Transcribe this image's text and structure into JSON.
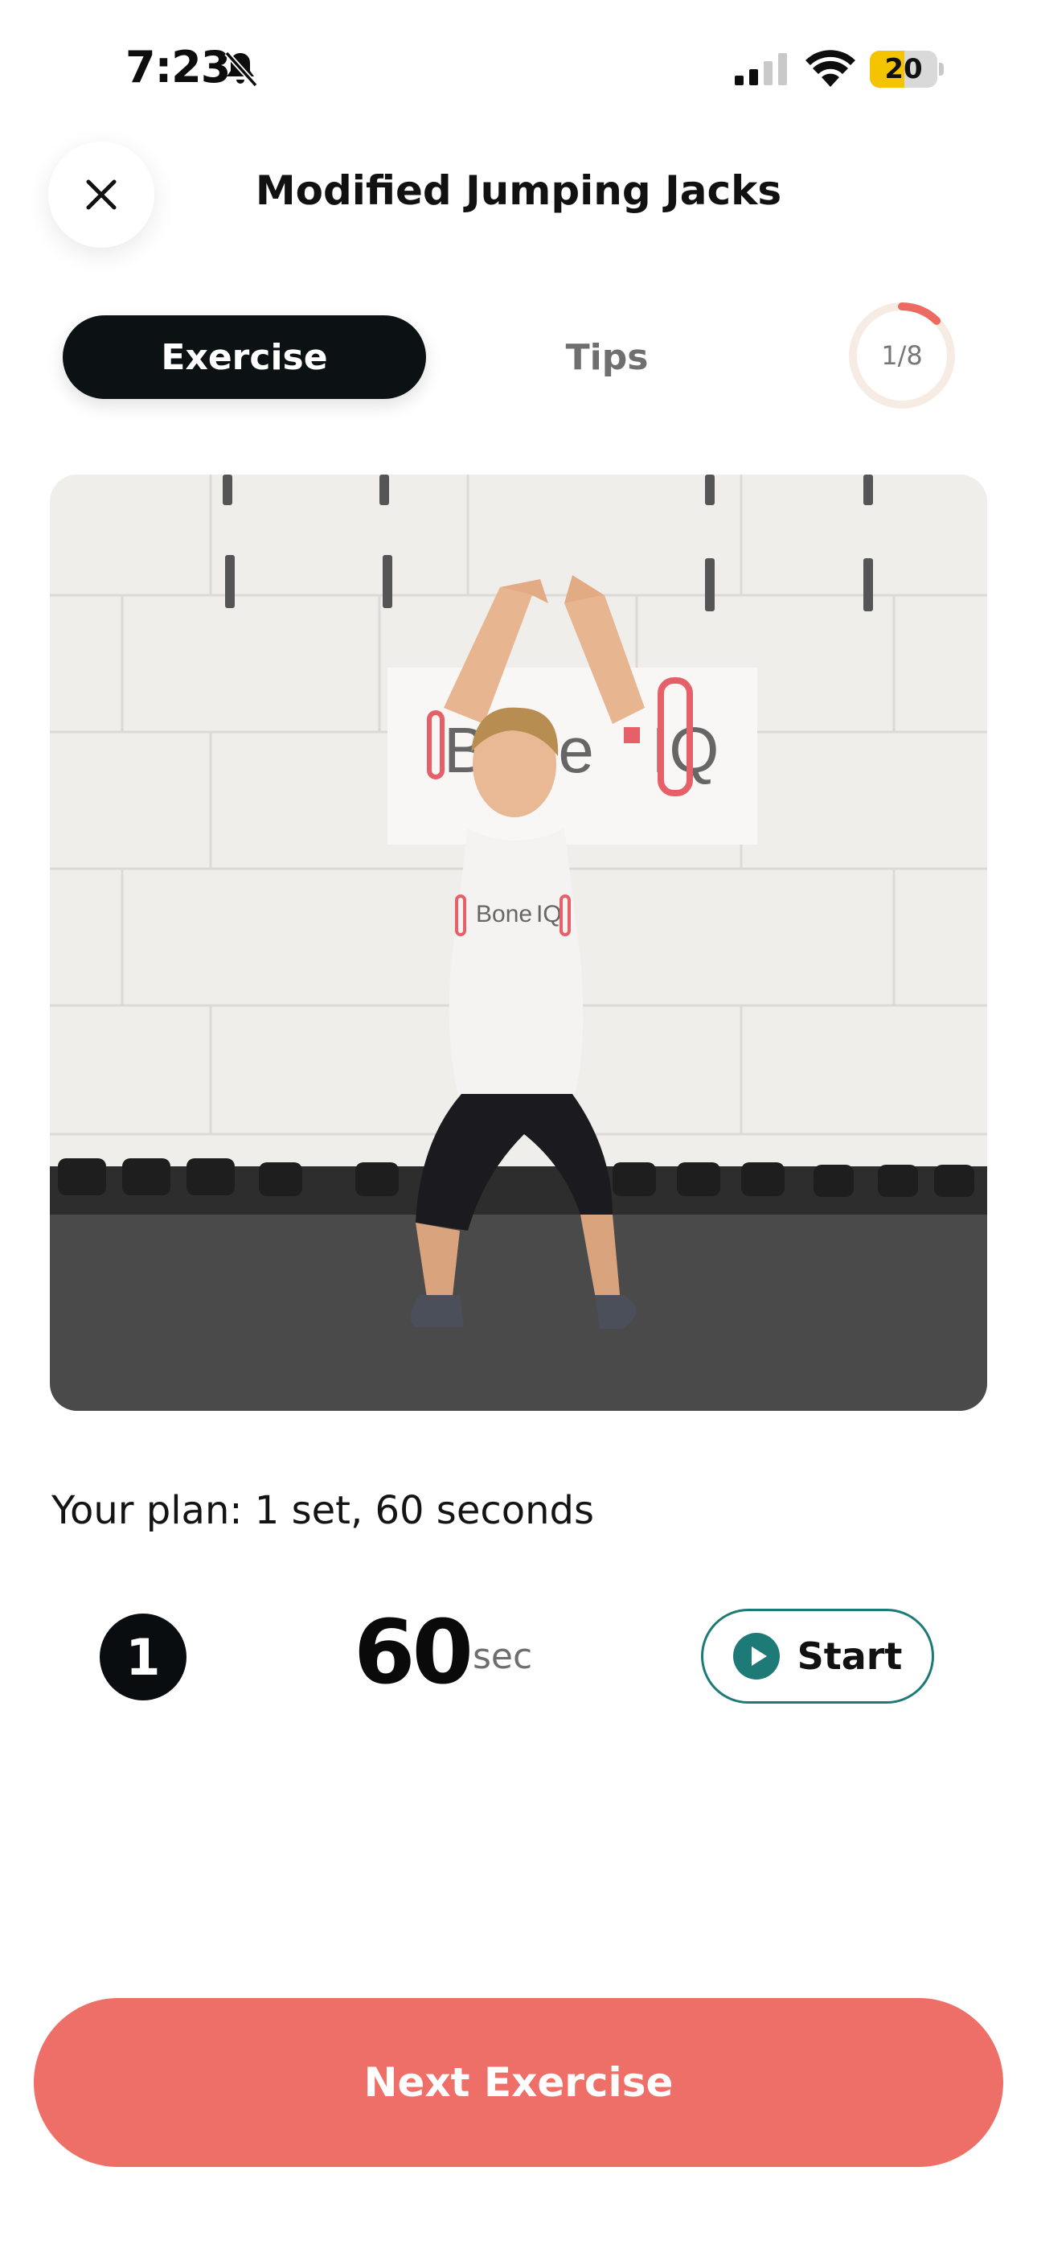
{
  "status_bar": {
    "time": "7:23",
    "battery": "20",
    "battery_level_pct": 20,
    "icons": [
      "bell-slash-icon",
      "cellular-signal-icon",
      "wifi-icon",
      "battery-icon"
    ]
  },
  "header": {
    "title": "Modified Jumping Jacks",
    "close_icon": "close-icon"
  },
  "tabs": [
    {
      "label": "Exercise",
      "selected": true
    },
    {
      "label": "Tips",
      "selected": false
    }
  ],
  "progress": {
    "label": "1/8",
    "current": 1,
    "total": 8,
    "colors": {
      "track": "#f6ece4",
      "fill": "#ec6a62"
    }
  },
  "media": {
    "type": "exercise-video-still",
    "wall_sign_text": "Bone-IQ",
    "shirt_text": "Bone-IQ"
  },
  "plan": {
    "summary": "Your plan: 1 set, 60 seconds",
    "set_number": "1",
    "duration_value": "60",
    "duration_unit": "sec",
    "start_label": "Start"
  },
  "footer": {
    "next_label": "Next Exercise"
  },
  "colors": {
    "accent": "#ed6f67",
    "teal": "#1d7a77",
    "dark": "#0c1114"
  }
}
